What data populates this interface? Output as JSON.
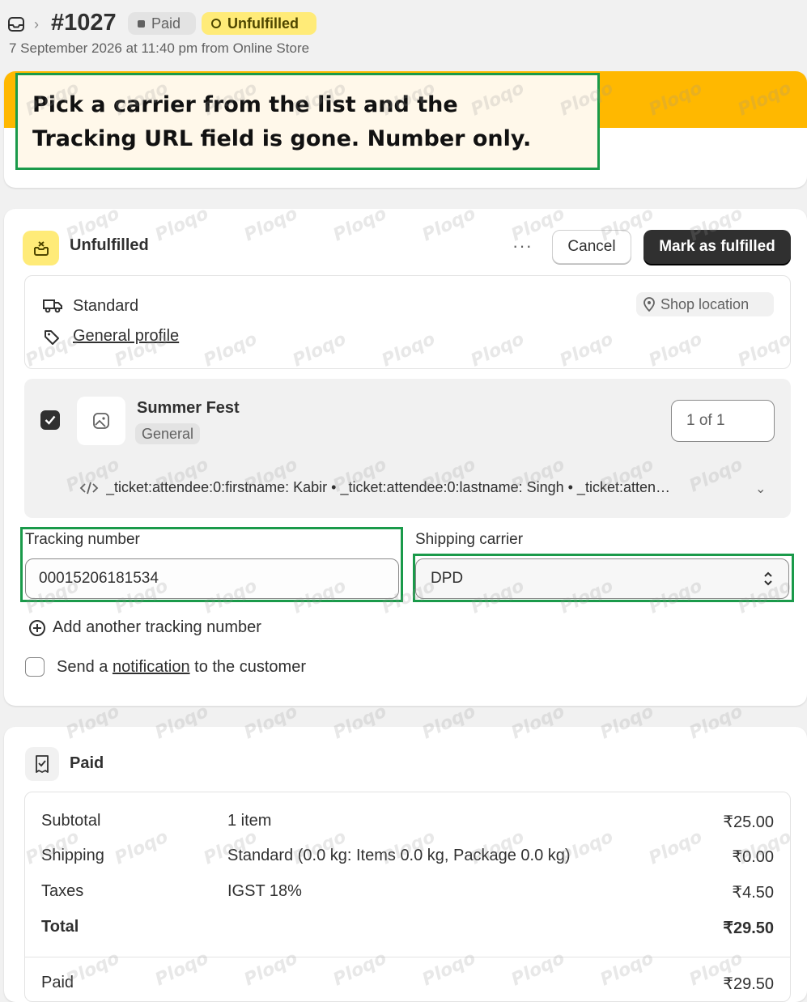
{
  "header": {
    "order_number": "#1027",
    "payment_status": "Paid",
    "fulfillment_status": "Unfulfilled",
    "subtitle": "7 September 2026 at 11:40 pm from Online Store"
  },
  "callout": {
    "line1": "Pick a carrier from the list and the",
    "line2": "Tracking URL field is gone. Number only."
  },
  "fulfillment": {
    "title": "Unfulfilled",
    "more_label": "···",
    "cancel_label": "Cancel",
    "mark_label": "Mark as fulfilled",
    "shipping_method": "Standard",
    "profile_link": "General profile",
    "location_label": "Shop location",
    "item": {
      "name": "Summer Fest",
      "variant": "General",
      "quantity": "1 of 1",
      "checked": true,
      "properties": "_ticket:attendee:0:firstname: Kabir • _ticket:attendee:0:lastname: Singh • _ticket:atten…"
    },
    "tracking_label": "Tracking number",
    "tracking_value": "00015206181534",
    "carrier_label": "Shipping carrier",
    "carrier_value": "DPD",
    "add_tracking_label": "Add another tracking number",
    "notify_prefix": "Send a",
    "notify_link": "notification",
    "notify_suffix": "to the customer"
  },
  "payment": {
    "title": "Paid",
    "rows": [
      {
        "label": "Subtotal",
        "detail": "1 item",
        "amount": "₹25.00"
      },
      {
        "label": "Shipping",
        "detail": "Standard (0.0 kg: Items 0.0 kg, Package 0.0 kg)",
        "amount": "₹0.00"
      },
      {
        "label": "Taxes",
        "detail": "IGST 18%",
        "amount": "₹4.50"
      },
      {
        "label": "Total",
        "detail": "",
        "amount": "₹29.50"
      }
    ],
    "paid_label": "Paid",
    "paid_amount": "₹29.50"
  },
  "colors": {
    "unfulfilled_badge": "#ffeb78",
    "banner": "#ffb800",
    "highlight_border": "#1a9a4a",
    "primary_button": "#303030"
  },
  "watermark_text": "Ploqo"
}
